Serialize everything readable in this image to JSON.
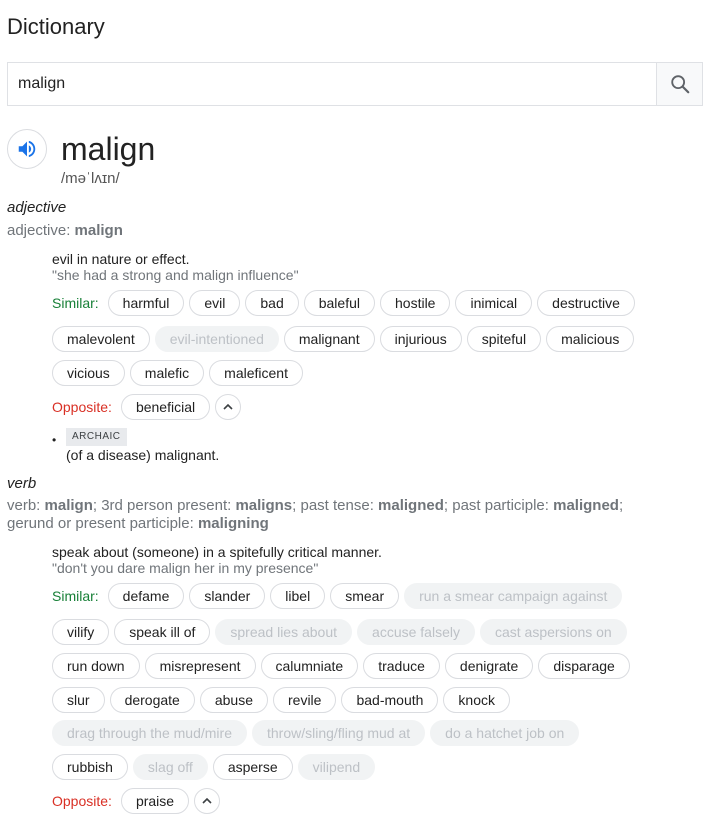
{
  "header": {
    "title": "Dictionary"
  },
  "search": {
    "value": "malign"
  },
  "entry": {
    "word": "malign",
    "phonetic": "/məˈlʌɪn/",
    "adjective": {
      "pos": "adjective",
      "inflection_label": "adjective: ",
      "inflection_word": "malign",
      "definition": "evil in nature or effect.",
      "example": "\"she had a strong and malign influence\"",
      "similar_label": "Similar:",
      "similar": [
        [
          {
            "t": "harmful",
            "muted": false
          },
          {
            "t": "evil",
            "muted": false
          },
          {
            "t": "bad",
            "muted": false
          },
          {
            "t": "baleful",
            "muted": false
          },
          {
            "t": "hostile",
            "muted": false
          },
          {
            "t": "inimical",
            "muted": false
          },
          {
            "t": "destructive",
            "muted": false
          }
        ],
        [
          {
            "t": "malevolent",
            "muted": false
          },
          {
            "t": "evil-intentioned",
            "muted": true
          },
          {
            "t": "malignant",
            "muted": false
          },
          {
            "t": "injurious",
            "muted": false
          },
          {
            "t": "spiteful",
            "muted": false
          },
          {
            "t": "malicious",
            "muted": false
          }
        ],
        [
          {
            "t": "vicious",
            "muted": false
          },
          {
            "t": "malefic",
            "muted": false
          },
          {
            "t": "maleficent",
            "muted": false
          }
        ]
      ],
      "opposite_label": "Opposite:",
      "opposite": [
        "beneficial"
      ],
      "archaic_tag": "ARCHAIC",
      "archaic_definition": "(of a disease) malignant."
    },
    "verb": {
      "pos": "verb",
      "inflection": [
        {
          "t": "verb: ",
          "b": false
        },
        {
          "t": "malign",
          "b": true
        },
        {
          "t": "; 3rd person present: ",
          "b": false
        },
        {
          "t": "maligns",
          "b": true
        },
        {
          "t": "; past tense: ",
          "b": false
        },
        {
          "t": "maligned",
          "b": true
        },
        {
          "t": "; past participle: ",
          "b": false
        },
        {
          "t": "maligned",
          "b": true
        },
        {
          "t": ";",
          "b": false
        },
        {
          "t": "BR",
          "b": false
        },
        {
          "t": "gerund or present participle: ",
          "b": false
        },
        {
          "t": "maligning",
          "b": true
        }
      ],
      "definition": "speak about (someone) in a spitefully critical manner.",
      "example": "\"don't you dare malign her in my presence\"",
      "similar_label": "Similar:",
      "similar": [
        [
          {
            "t": "defame",
            "muted": false
          },
          {
            "t": "slander",
            "muted": false
          },
          {
            "t": "libel",
            "muted": false
          },
          {
            "t": "smear",
            "muted": false
          },
          {
            "t": "run a smear campaign against",
            "muted": true
          }
        ],
        [
          {
            "t": "vilify",
            "muted": false
          },
          {
            "t": "speak ill of",
            "muted": false
          },
          {
            "t": "spread lies about",
            "muted": true
          },
          {
            "t": "accuse falsely",
            "muted": true
          },
          {
            "t": "cast aspersions on",
            "muted": true
          }
        ],
        [
          {
            "t": "run down",
            "muted": false
          },
          {
            "t": "misrepresent",
            "muted": false
          },
          {
            "t": "calumniate",
            "muted": false
          },
          {
            "t": "traduce",
            "muted": false
          },
          {
            "t": "denigrate",
            "muted": false
          },
          {
            "t": "disparage",
            "muted": false
          }
        ],
        [
          {
            "t": "slur",
            "muted": false
          },
          {
            "t": "derogate",
            "muted": false
          },
          {
            "t": "abuse",
            "muted": false
          },
          {
            "t": "revile",
            "muted": false
          },
          {
            "t": "bad-mouth",
            "muted": false
          },
          {
            "t": "knock",
            "muted": false
          }
        ],
        [
          {
            "t": "drag through the mud/mire",
            "muted": true
          },
          {
            "t": "throw/sling/fling mud at",
            "muted": true
          },
          {
            "t": "do a hatchet job on",
            "muted": true
          }
        ],
        [
          {
            "t": "rubbish",
            "muted": false
          },
          {
            "t": "slag off",
            "muted": true
          },
          {
            "t": "asperse",
            "muted": false
          },
          {
            "t": "vilipend",
            "muted": true
          }
        ]
      ],
      "opposite_label": "Opposite:",
      "opposite": [
        "praise"
      ]
    }
  },
  "colors": {
    "similar": "#188038",
    "opposite": "#d93025",
    "speaker": "#1a73e8",
    "muted_chip": "#bdc1c6"
  },
  "icons": {
    "search": "search-icon",
    "speaker": "speaker-icon",
    "collapse": "chevron-up-icon"
  }
}
